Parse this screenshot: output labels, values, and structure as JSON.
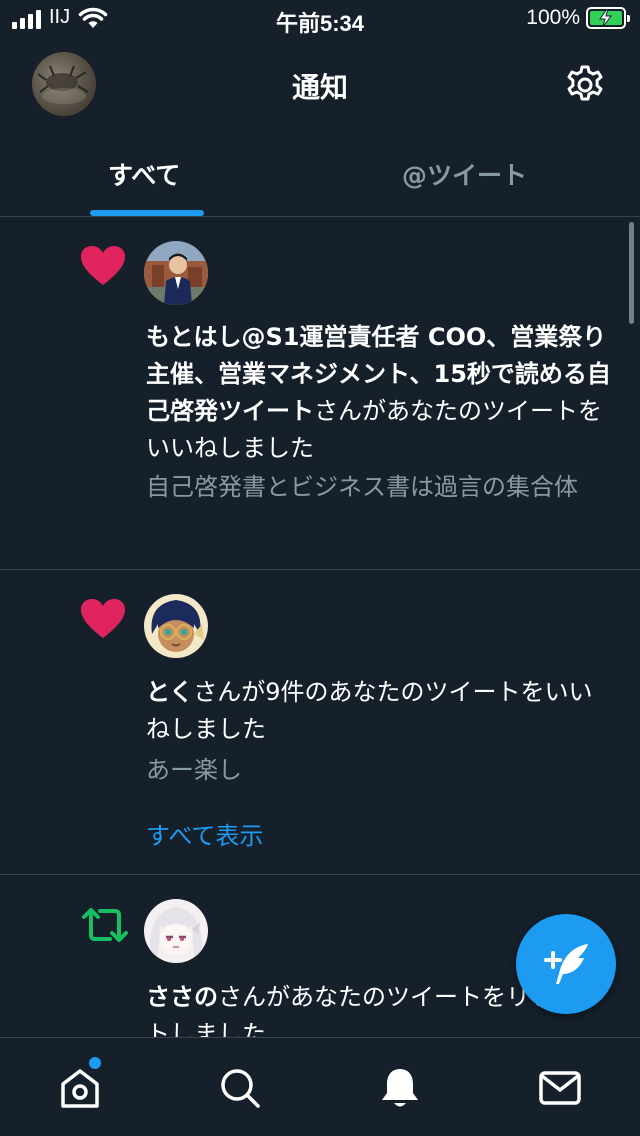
{
  "status_bar": {
    "carrier": "IIJ",
    "time": "午前5:34",
    "battery_percent": "100%"
  },
  "header": {
    "title": "通知"
  },
  "tabs": [
    {
      "label": "すべて",
      "active": true
    },
    {
      "label": "@ツイート",
      "active": false
    }
  ],
  "notifications": [
    {
      "type": "like",
      "icon": "heart-icon",
      "icon_color": "#e0245e",
      "user": "もとはし@S1運営責任者 COO、営業祭り主催、営業マネジメント、15秒で読める自己啓発ツイート",
      "action": "さんがあなたのツイートをいいねしました",
      "tweet_preview": "自己啓発書とビジネス書は過言の集合体"
    },
    {
      "type": "like",
      "icon": "heart-icon",
      "icon_color": "#e0245e",
      "user": "とく",
      "action": "さんが9件のあなたのツイートをいいねしました",
      "tweet_preview": "あー楽し",
      "show_all_label": "すべて表示"
    },
    {
      "type": "retweet",
      "icon": "retweet-icon",
      "icon_color": "#17bf63",
      "user": "ささの",
      "action": "さんがあなたのツイートをリツイートしました"
    }
  ],
  "fab": {
    "icon": "compose-tweet-icon"
  },
  "bottom_nav": [
    {
      "name": "home",
      "icon": "home-icon",
      "has_badge": true
    },
    {
      "name": "search",
      "icon": "search-icon"
    },
    {
      "name": "notifications",
      "icon": "bell-icon",
      "active": true
    },
    {
      "name": "messages",
      "icon": "mail-icon"
    }
  ],
  "colors": {
    "background": "#15202b",
    "accent": "#1d9bf0",
    "secondary_text": "#8899a6",
    "divider": "#38444d"
  }
}
